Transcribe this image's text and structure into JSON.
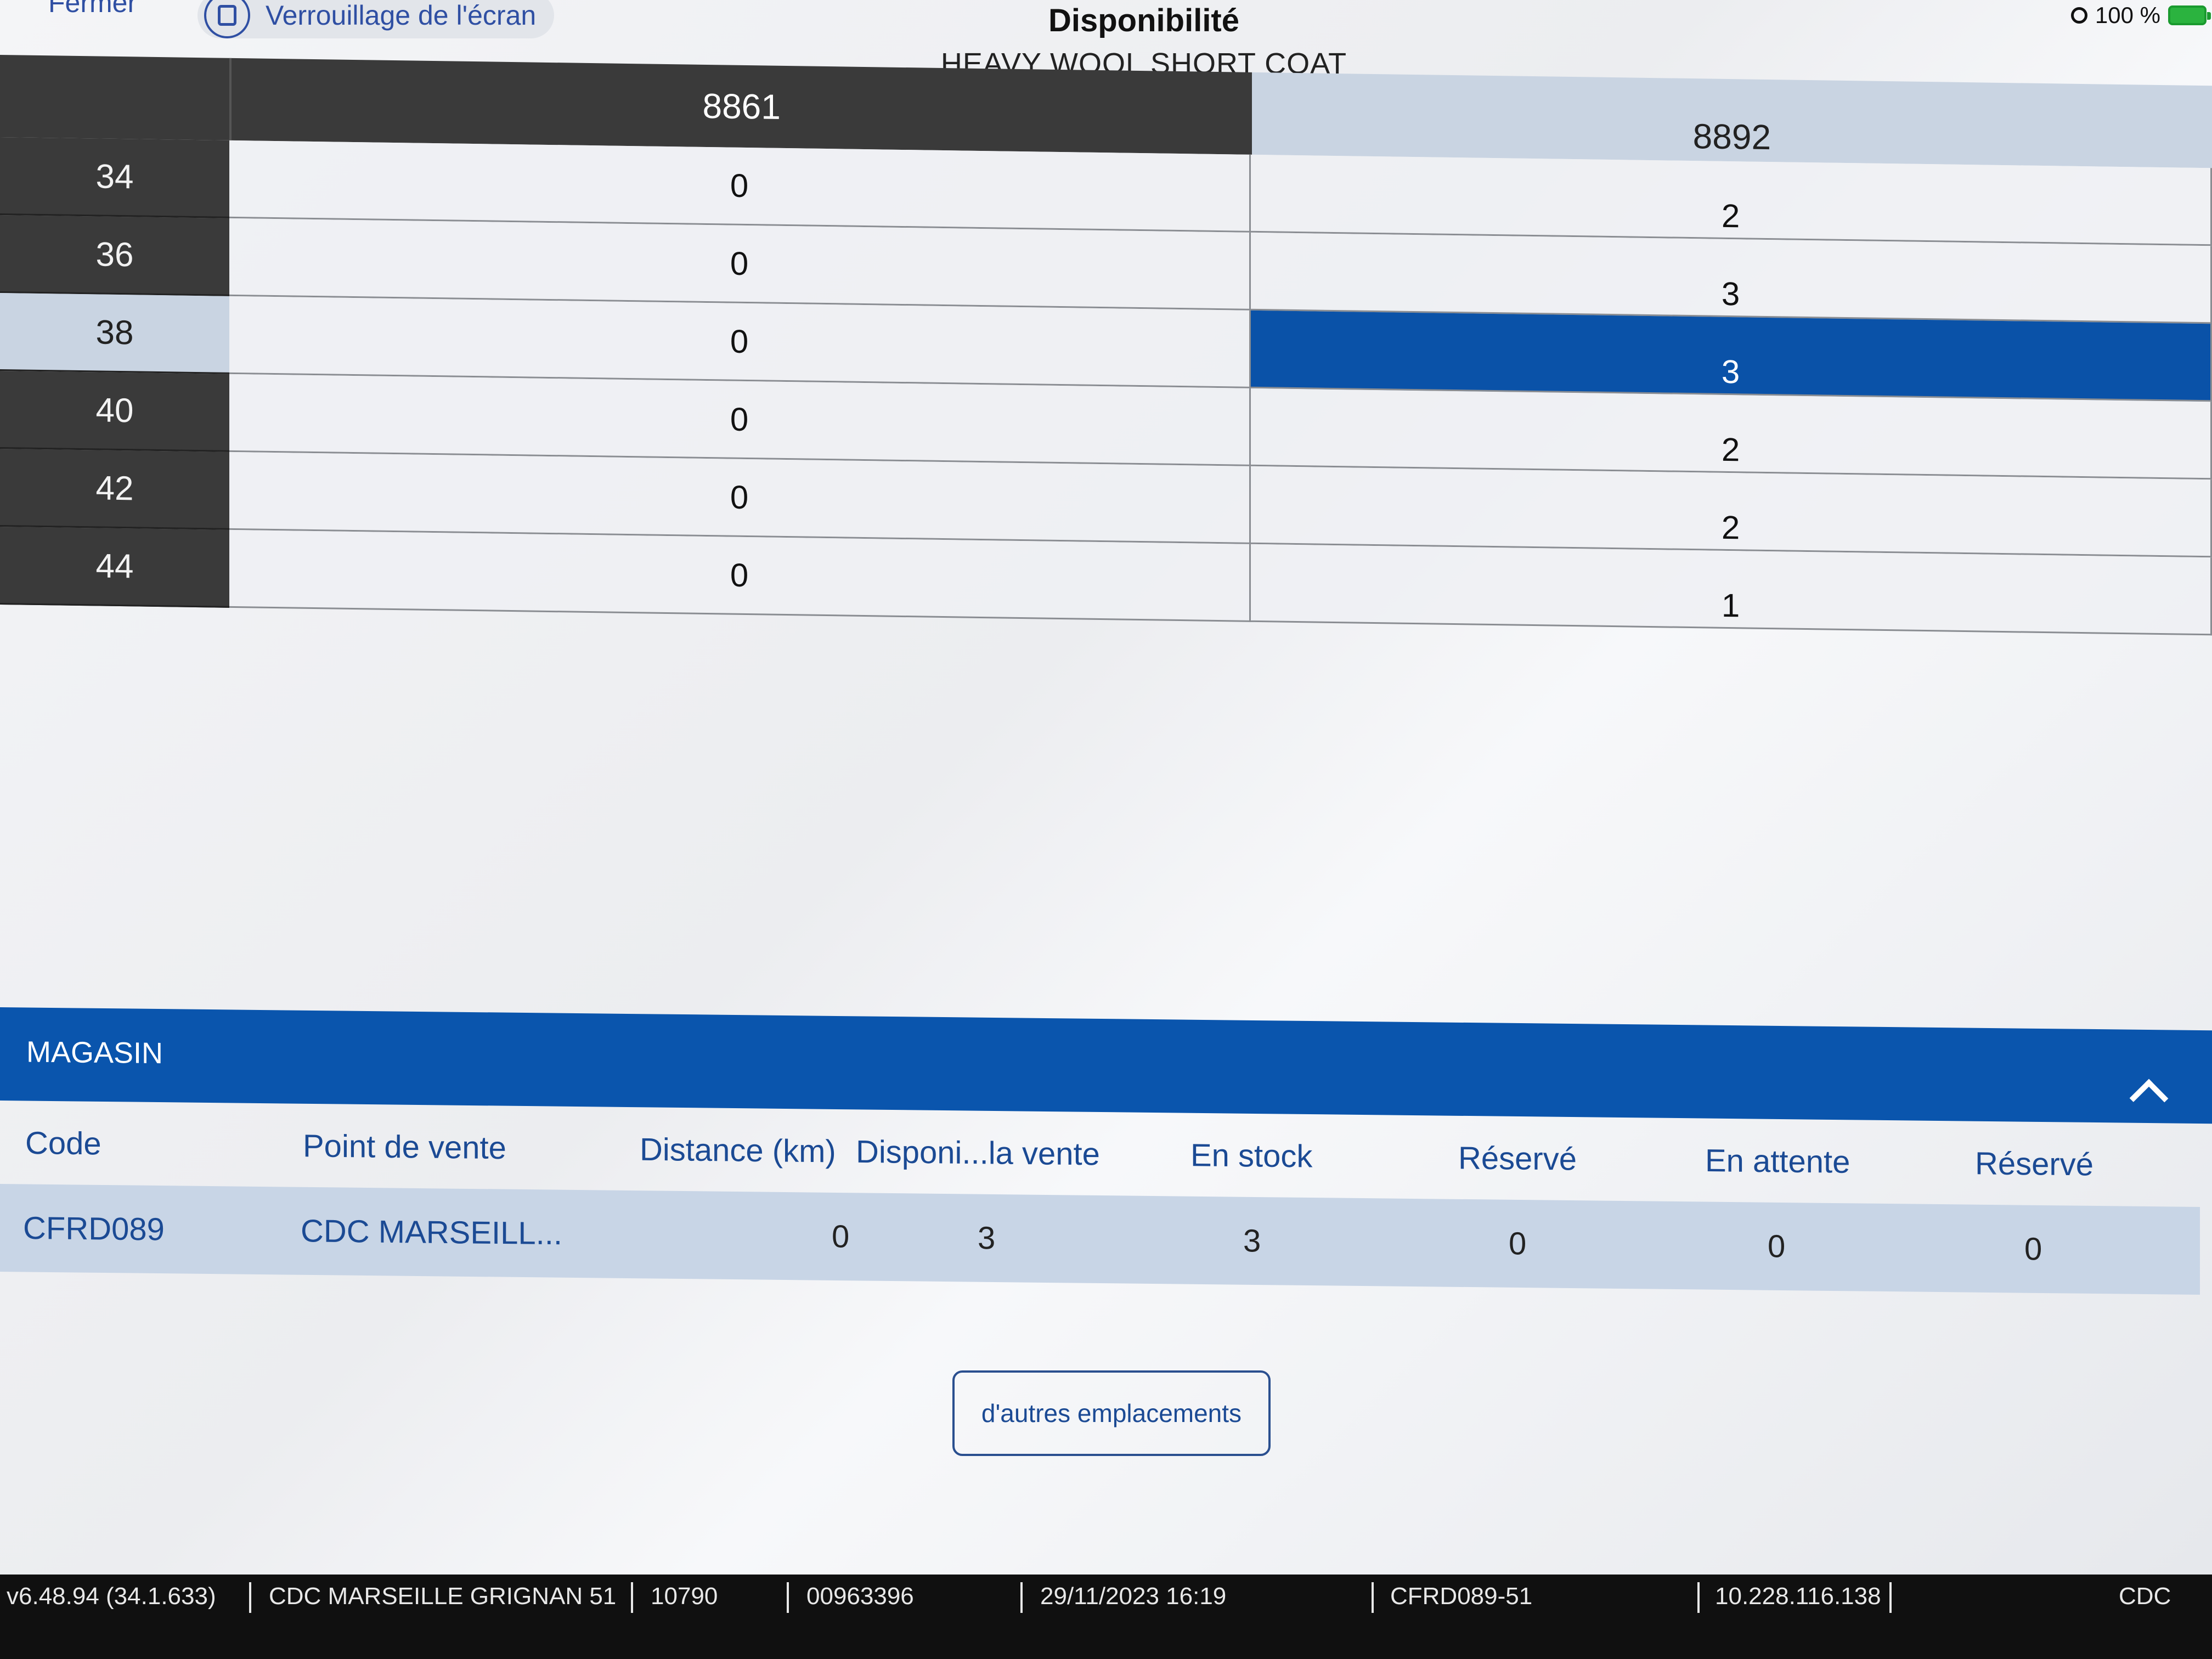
{
  "header": {
    "close_label": "Fermer",
    "lock_label": "Verrouillage de l'écran",
    "title": "Disponibilité",
    "subtitle": "HEAVY WOOL SHORT COAT",
    "battery": "100 %"
  },
  "grid": {
    "columns": [
      "8861",
      "8892"
    ],
    "rows": [
      {
        "size": "34",
        "values": [
          "0",
          "2"
        ]
      },
      {
        "size": "36",
        "values": [
          "0",
          "3"
        ]
      },
      {
        "size": "38",
        "values": [
          "0",
          "3"
        ]
      },
      {
        "size": "40",
        "values": [
          "0",
          "2"
        ]
      },
      {
        "size": "42",
        "values": [
          "0",
          "2"
        ]
      },
      {
        "size": "44",
        "values": [
          "0",
          "1"
        ]
      }
    ],
    "selected": {
      "size": "38",
      "column": "8892"
    }
  },
  "store": {
    "title": "MAGASIN",
    "columns": [
      "Code",
      "Point de vente",
      "Distance (km)",
      "Disponi...la vente",
      "En stock",
      "Réservé",
      "En attente",
      "Réservé"
    ],
    "rows": [
      [
        "CFRD089",
        "CDC MARSEILL...",
        "0",
        "3",
        "3",
        "0",
        "0",
        "0"
      ]
    ],
    "more_button": "d'autres emplacements"
  },
  "footer": {
    "items": [
      "v6.48.94 (34.1.633)",
      "CDC MARSEILLE GRIGNAN 51",
      "10790",
      "00963396",
      "29/11/2023 16:19",
      "CFRD089-51",
      "10.228.116.138",
      "CDC"
    ]
  },
  "colors": {
    "accent": "#0a55ad",
    "dark_header": "#3a3a3a",
    "light_header": "#c9d4e2",
    "link": "#1b4a94"
  }
}
